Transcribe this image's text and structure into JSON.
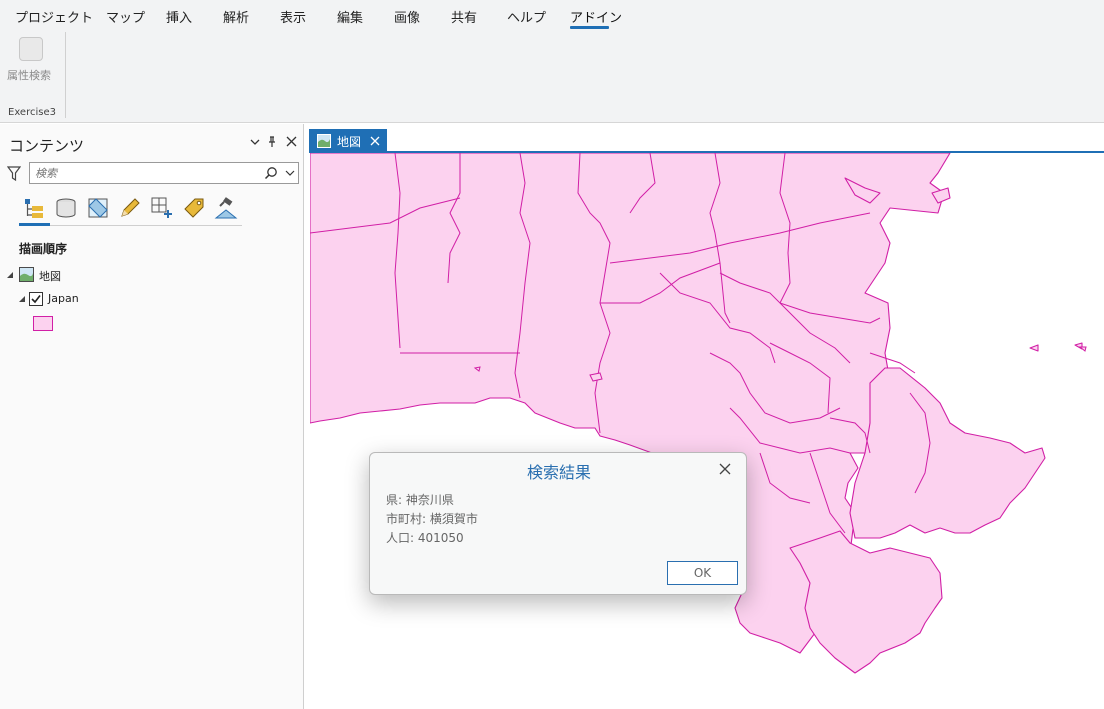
{
  "menu": {
    "items": [
      "プロジェクト",
      "マップ",
      "挿入",
      "解析",
      "表示",
      "編集",
      "画像",
      "共有",
      "ヘルプ",
      "アドイン"
    ],
    "active": "アドイン"
  },
  "ribbon": {
    "button_label": "属性検索",
    "group_label": "Exercise3"
  },
  "contents_pane": {
    "title": "コンテンツ",
    "search_placeholder": "検索",
    "section_heading": "描画順序",
    "tree": {
      "map_label": "地図",
      "layer_label": "Japan",
      "layer_checked": true
    },
    "icons": [
      "list-by-drawing-order-icon",
      "list-by-source-icon",
      "list-by-selection-icon",
      "list-by-editing-icon",
      "list-by-snapping-icon",
      "list-by-labeling-icon",
      "list-by-perspective-imagery-icon"
    ]
  },
  "map_tab": {
    "label": "地図"
  },
  "colors": {
    "accent": "#1f6fb5",
    "polygon_fill": "#fcd2ef",
    "polygon_stroke": "#d11fa6",
    "dialog_title": "#2a6fb0"
  },
  "dialog": {
    "title": "検索結果",
    "lines": [
      "県: 神奈川県",
      "市町村: 横須賀市",
      "人口: 401050"
    ],
    "ok_label": "OK"
  }
}
